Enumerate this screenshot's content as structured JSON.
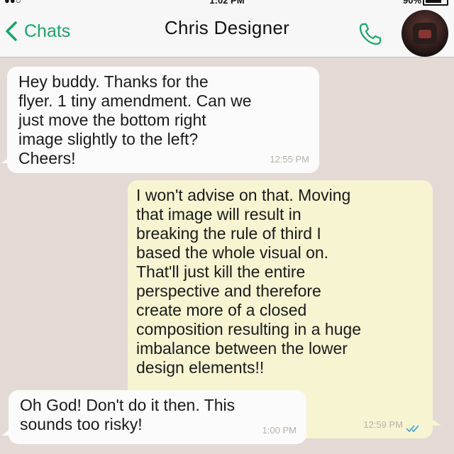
{
  "status": {
    "time": "1:02 PM",
    "battery": "90%"
  },
  "header": {
    "back_label": "Chats",
    "contact_name": "Chris Designer"
  },
  "messages": [
    {
      "direction": "in",
      "text": "Hey buddy. Thanks for the\nflyer. 1 tiny amendment. Can we\njust move the bottom right\nimage slightly to the left?\nCheers!",
      "time": "12:55 PM"
    },
    {
      "direction": "out",
      "text": "I won't advise on that. Moving\nthat image will result in\nbreaking the rule of third I\nbased the whole visual on.\nThat'll just kill the entire\nperspective and therefore\ncreate more of a closed\ncomposition resulting in a huge\nimbalance between the lower\ndesign elements!!",
      "time": "12:59 PM",
      "read_receipt": "double-check-icon"
    },
    {
      "direction": "in",
      "text": "Oh God! Don't do it then. This\nsounds too risky!",
      "time": "1:00 PM"
    }
  ],
  "colors": {
    "accent": "#1aa368",
    "background": "#e3dad6",
    "incoming": "#fbfbfb",
    "outgoing": "#f7f4d2",
    "read_ticks": "#4fa8d8"
  }
}
